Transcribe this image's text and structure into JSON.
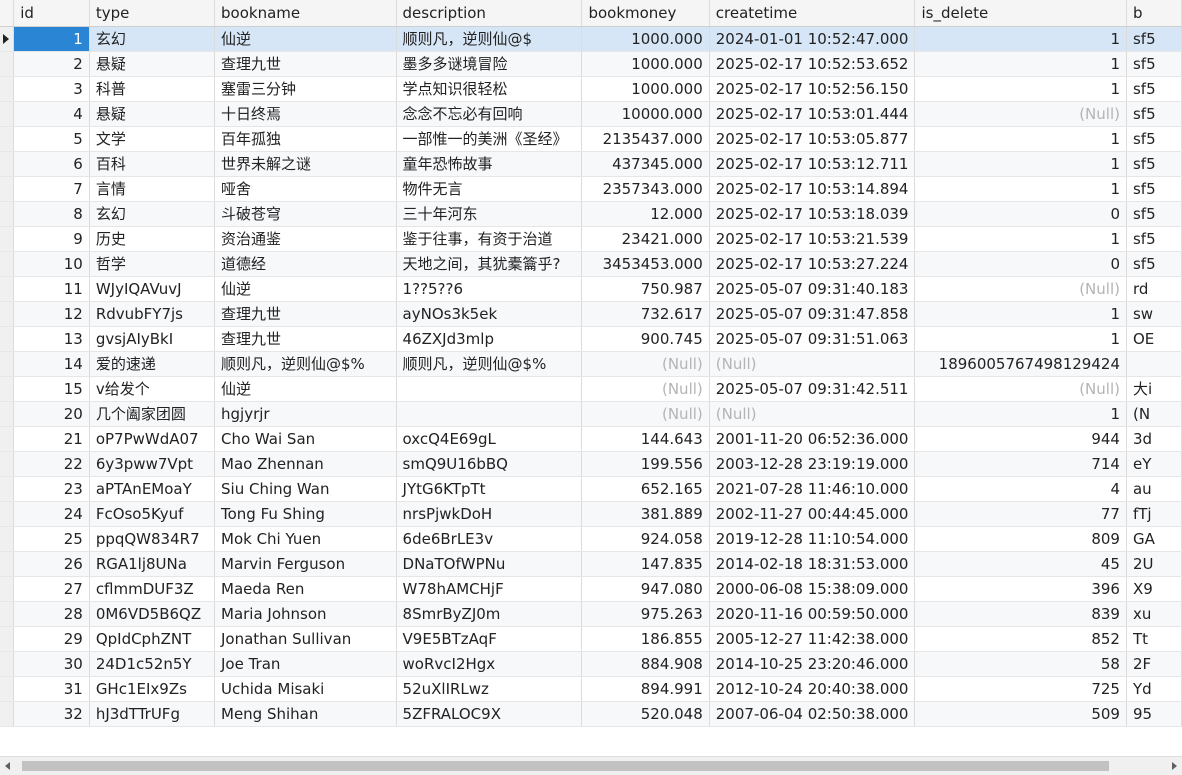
{
  "columns": [
    "id",
    "type",
    "bookname",
    "description",
    "bookmoney",
    "createtime",
    "is_delete",
    "b"
  ],
  "null_text": "(Null)",
  "rows": [
    {
      "id": "1",
      "type": "玄幻",
      "bookname": "仙逆",
      "description": "顺则凡，逆则仙@$",
      "bookmoney": "1000.000",
      "createtime": "2024-01-01 10:52:47.000",
      "is_delete": "1",
      "b": "sf5"
    },
    {
      "id": "2",
      "type": "悬疑",
      "bookname": "查理九世",
      "description": "墨多多谜境冒险",
      "bookmoney": "1000.000",
      "createtime": "2025-02-17 10:52:53.652",
      "is_delete": "1",
      "b": "sf5"
    },
    {
      "id": "3",
      "type": "科普",
      "bookname": "塞雷三分钟",
      "description": "学点知识很轻松",
      "bookmoney": "1000.000",
      "createtime": "2025-02-17 10:52:56.150",
      "is_delete": "1",
      "b": "sf5"
    },
    {
      "id": "4",
      "type": "悬疑",
      "bookname": "十日终焉",
      "description": "念念不忘必有回响",
      "bookmoney": "10000.000",
      "createtime": "2025-02-17 10:53:01.444",
      "is_delete": null,
      "b": "sf5"
    },
    {
      "id": "5",
      "type": "文学",
      "bookname": "百年孤独",
      "description": "一部惟一的美洲《圣经》",
      "bookmoney": "2135437.000",
      "createtime": "2025-02-17 10:53:05.877",
      "is_delete": "1",
      "b": "sf5"
    },
    {
      "id": "6",
      "type": "百科",
      "bookname": "世界未解之谜",
      "description": "童年恐怖故事",
      "bookmoney": "437345.000",
      "createtime": "2025-02-17 10:53:12.711",
      "is_delete": "1",
      "b": "sf5"
    },
    {
      "id": "7",
      "type": "言情",
      "bookname": "哑舍",
      "description": "物件无言",
      "bookmoney": "2357343.000",
      "createtime": "2025-02-17 10:53:14.894",
      "is_delete": "1",
      "b": "sf5"
    },
    {
      "id": "8",
      "type": "玄幻",
      "bookname": "斗破苍穹",
      "description": "三十年河东",
      "bookmoney": "12.000",
      "createtime": "2025-02-17 10:53:18.039",
      "is_delete": "0",
      "b": "sf5"
    },
    {
      "id": "9",
      "type": "历史",
      "bookname": "资治通鉴",
      "description": "鉴于往事，有资于治道",
      "bookmoney": "23421.000",
      "createtime": "2025-02-17 10:53:21.539",
      "is_delete": "1",
      "b": "sf5"
    },
    {
      "id": "10",
      "type": "哲学",
      "bookname": "道德经",
      "description": "天地之间，其犹橐籥乎?",
      "bookmoney": "3453453.000",
      "createtime": "2025-02-17 10:53:27.224",
      "is_delete": "0",
      "b": "sf5"
    },
    {
      "id": "11",
      "type": "WJyIQAVuvJ",
      "bookname": "仙逆",
      "description": "1??5??6",
      "bookmoney": "750.987",
      "createtime": "2025-05-07 09:31:40.183",
      "is_delete": null,
      "b": "rd"
    },
    {
      "id": "12",
      "type": "RdvubFY7js",
      "bookname": "查理九世",
      "description": "ayNOs3k5ek",
      "bookmoney": "732.617",
      "createtime": "2025-05-07 09:31:47.858",
      "is_delete": "1",
      "b": "sw"
    },
    {
      "id": "13",
      "type": "gvsjAIyBkI",
      "bookname": "查理九世",
      "description": "46ZXJd3mlp",
      "bookmoney": "900.745",
      "createtime": "2025-05-07 09:31:51.063",
      "is_delete": "1",
      "b": "OE"
    },
    {
      "id": "14",
      "type": "爱的速递",
      "bookname": "顺则凡，逆则仙@$%",
      "description": "顺则凡，逆则仙@$%",
      "bookmoney": null,
      "createtime": null,
      "is_delete": "1896005767498129424",
      "b": ""
    },
    {
      "id": "15",
      "type": "v给发个",
      "bookname": "仙逆",
      "description": "",
      "bookmoney": null,
      "createtime": "2025-05-07 09:31:42.511",
      "is_delete": null,
      "b": "大i"
    },
    {
      "id": "20",
      "type": "几个阖家团圆",
      "bookname": "hgjyrjr",
      "description": "",
      "bookmoney": null,
      "createtime": null,
      "is_delete": "1",
      "b": "(N"
    },
    {
      "id": "21",
      "type": "oP7PwWdA07",
      "bookname": "Cho Wai San",
      "description": "oxcQ4E69gL",
      "bookmoney": "144.643",
      "createtime": "2001-11-20 06:52:36.000",
      "is_delete": "944",
      "b": "3d"
    },
    {
      "id": "22",
      "type": "6y3pww7Vpt",
      "bookname": "Mao Zhennan",
      "description": "smQ9U16bBQ",
      "bookmoney": "199.556",
      "createtime": "2003-12-28 23:19:19.000",
      "is_delete": "714",
      "b": "eY"
    },
    {
      "id": "23",
      "type": "aPTAnEMoaY",
      "bookname": "Siu Ching Wan",
      "description": "JYtG6KTpTt",
      "bookmoney": "652.165",
      "createtime": "2021-07-28 11:46:10.000",
      "is_delete": "4",
      "b": "au"
    },
    {
      "id": "24",
      "type": "FcOso5Kyuf",
      "bookname": "Tong Fu Shing",
      "description": "nrsPjwkDoH",
      "bookmoney": "381.889",
      "createtime": "2002-11-27 00:44:45.000",
      "is_delete": "77",
      "b": "fTj"
    },
    {
      "id": "25",
      "type": "ppqQW834R7",
      "bookname": "Mok Chi Yuen",
      "description": "6de6BrLE3v",
      "bookmoney": "924.058",
      "createtime": "2019-12-28 11:10:54.000",
      "is_delete": "809",
      "b": "GA"
    },
    {
      "id": "26",
      "type": "RGA1lj8UNa",
      "bookname": "Marvin Ferguson",
      "description": "DNaTOfWPNu",
      "bookmoney": "147.835",
      "createtime": "2014-02-18 18:31:53.000",
      "is_delete": "45",
      "b": "2U"
    },
    {
      "id": "27",
      "type": "cflmmDUF3Z",
      "bookname": "Maeda Ren",
      "description": "W78hAMCHjF",
      "bookmoney": "947.080",
      "createtime": "2000-06-08 15:38:09.000",
      "is_delete": "396",
      "b": "X9"
    },
    {
      "id": "28",
      "type": "0M6VD5B6QZ",
      "bookname": "Maria Johnson",
      "description": "8SmrByZJ0m",
      "bookmoney": "975.263",
      "createtime": "2020-11-16 00:59:50.000",
      "is_delete": "839",
      "b": "xu"
    },
    {
      "id": "29",
      "type": "QpIdCphZNT",
      "bookname": "Jonathan Sullivan",
      "description": "V9E5BTzAqF",
      "bookmoney": "186.855",
      "createtime": "2005-12-27 11:42:38.000",
      "is_delete": "852",
      "b": "Tt"
    },
    {
      "id": "30",
      "type": "24D1c52n5Y",
      "bookname": "Joe Tran",
      "description": "woRvcI2Hgx",
      "bookmoney": "884.908",
      "createtime": "2014-10-25 23:20:46.000",
      "is_delete": "58",
      "b": "2F"
    },
    {
      "id": "31",
      "type": "GHc1EIx9Zs",
      "bookname": "Uchida Misaki",
      "description": "52uXlIRLwz",
      "bookmoney": "894.991",
      "createtime": "2012-10-24 20:40:38.000",
      "is_delete": "725",
      "b": "Yd"
    },
    {
      "id": "32",
      "type": "hJ3dTTrUFg",
      "bookname": "Meng Shihan",
      "description": "5ZFRALOC9X",
      "bookmoney": "520.048",
      "createtime": "2007-06-04 02:50:38.000",
      "is_delete": "509",
      "b": "95"
    }
  ],
  "selected_row": 0,
  "colors": {
    "selected_id_bg": "#2a85d4",
    "selected_row_bg": "#d7e6f6",
    "null_text": "#b4b4b4"
  }
}
